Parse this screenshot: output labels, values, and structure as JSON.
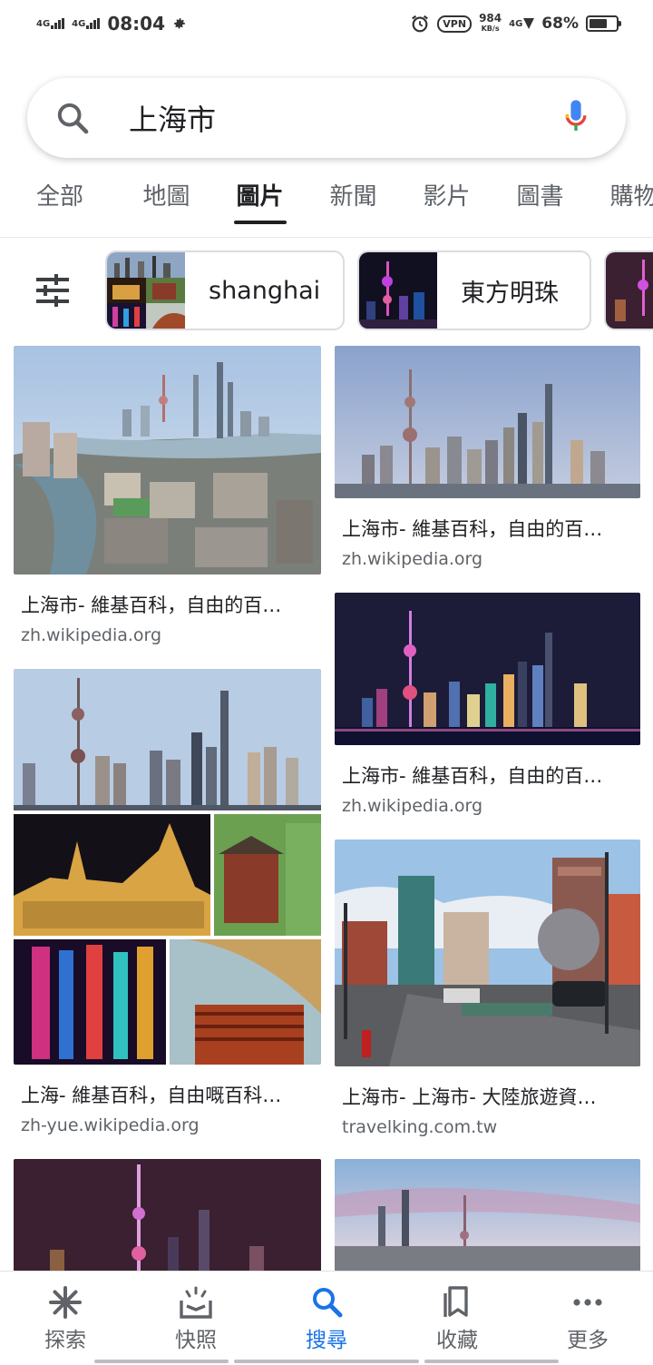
{
  "status_bar": {
    "net1": "4G",
    "net2": "4G",
    "time": "08:04",
    "vpn": "VPN",
    "speed_value": "984",
    "speed_unit": "KB/s",
    "net3": "4G",
    "battery_pct_text": "68%",
    "battery_level": 0.68
  },
  "search": {
    "query": "上海市"
  },
  "tabs": [
    "全部",
    "地圖",
    "圖片",
    "新聞",
    "影片",
    "圖書",
    "購物"
  ],
  "active_tab": "圖片",
  "chips": [
    {
      "label": "shanghai"
    },
    {
      "label": "東方明珠"
    },
    {
      "label": ""
    }
  ],
  "results": [
    {
      "title": "上海市- 維基百科，自由的百…",
      "source": "zh.wikipedia.org"
    },
    {
      "title": "上海市- 維基百科，自由的百…",
      "source": "zh.wikipedia.org"
    },
    {
      "title": "上海市- 維基百科，自由的百…",
      "source": "zh.wikipedia.org"
    },
    {
      "title": "上海- 維基百科，自由嘅百科…",
      "source": "zh-yue.wikipedia.org"
    },
    {
      "title": "上海市- 上海市- 大陸旅遊資…",
      "source": "travelking.com.tw"
    }
  ],
  "bottom_nav": [
    {
      "label": "探索",
      "icon": "asterisk-icon"
    },
    {
      "label": "快照",
      "icon": "snapshot-icon"
    },
    {
      "label": "搜尋",
      "icon": "search-icon"
    },
    {
      "label": "收藏",
      "icon": "collections-icon"
    },
    {
      "label": "更多",
      "icon": "more-icon"
    }
  ],
  "colors": {
    "accent": "#1a73e8",
    "mic_blue": "#4285f4",
    "mic_red": "#ea4335",
    "mic_yellow": "#fbbc05",
    "mic_green": "#34a853"
  }
}
